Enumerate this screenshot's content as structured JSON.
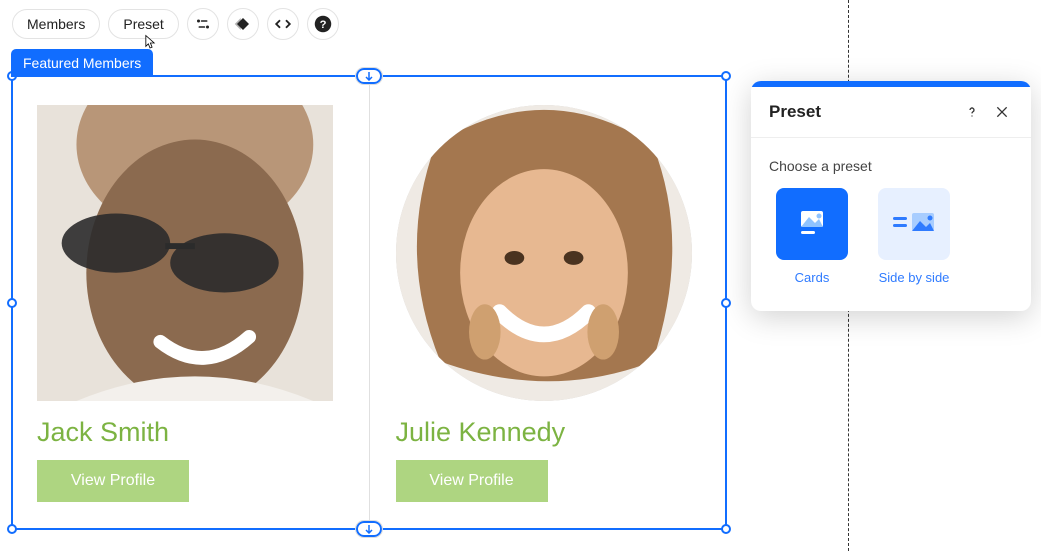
{
  "toolbar": {
    "members_label": "Members",
    "preset_label": "Preset"
  },
  "badge": {
    "label": "Featured Members"
  },
  "members": [
    {
      "name": "Jack Smith",
      "action": "View Profile"
    },
    {
      "name": "Julie Kennedy",
      "action": "View Profile"
    }
  ],
  "panel": {
    "title": "Preset",
    "subtitle": "Choose a preset",
    "options": [
      {
        "label": "Cards",
        "selected": true
      },
      {
        "label": "Side by side",
        "selected": false
      }
    ]
  }
}
